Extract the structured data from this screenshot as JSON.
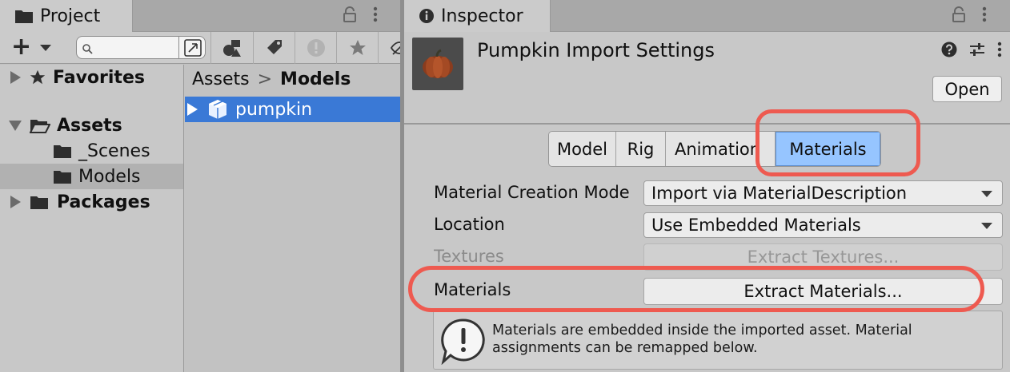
{
  "project_panel": {
    "tab_title": "Project",
    "toolbar": {
      "add_label": "+",
      "search_placeholder": "",
      "icons": [
        "search-by-type-icon",
        "label-icon",
        "error-icon",
        "favorite-icon",
        "hidden-packages-icon"
      ]
    },
    "tree": [
      {
        "label": "Favorites",
        "bold": true,
        "expanded": false
      },
      {
        "label": "Assets",
        "bold": true,
        "expanded": true
      },
      {
        "label": "_Scenes",
        "bold": false
      },
      {
        "label": "Models",
        "bold": false,
        "selected": true
      },
      {
        "label": "Packages",
        "bold": true,
        "expanded": false
      }
    ],
    "breadcrumb": {
      "root": "Assets",
      "separator": ">",
      "current": "Models"
    },
    "files": [
      {
        "label": "pumpkin",
        "selected": true
      }
    ]
  },
  "inspector": {
    "tab_title": "Inspector",
    "header_title": "Pumpkin Import Settings",
    "open_label": "Open",
    "tabs": [
      {
        "label": "Model"
      },
      {
        "label": "Rig"
      },
      {
        "label": "Animation"
      },
      {
        "label": "Materials",
        "active": true
      }
    ],
    "properties": {
      "creation_mode_label": "Material Creation Mode",
      "creation_mode_value": "Import via MaterialDescription",
      "location_label": "Location",
      "location_value": "Use Embedded Materials",
      "textures_label": "Textures",
      "textures_button": "Extract Textures...",
      "materials_label": "Materials",
      "materials_button": "Extract Materials..."
    },
    "help_text": "Materials are embedded inside the imported asset. Material assignments can be remapped below."
  },
  "colors": {
    "selection_blue": "#3a79d6",
    "active_tab_blue": "#96c5ff",
    "highlight_red": "#ee5a50"
  }
}
